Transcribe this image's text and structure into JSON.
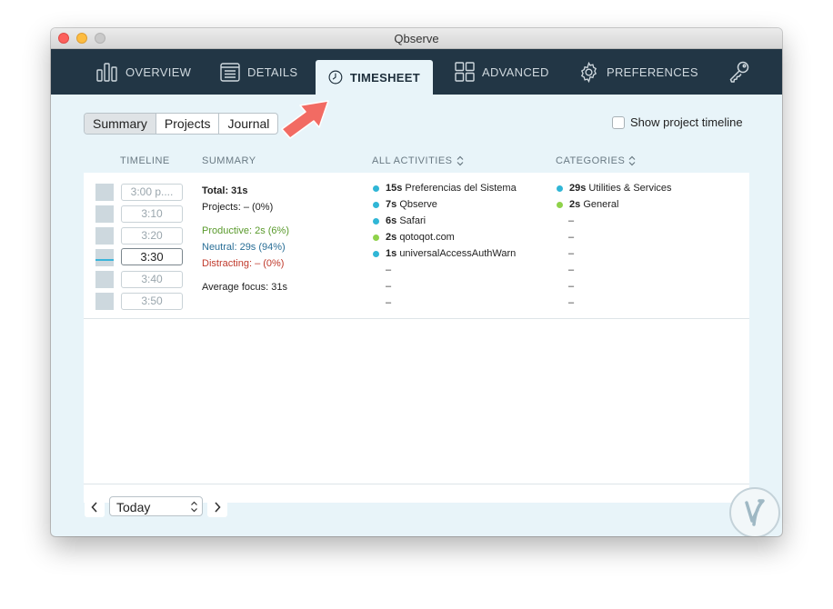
{
  "window": {
    "title": "Qbserve"
  },
  "tabs": [
    {
      "label": "OVERVIEW",
      "icon": "bar-chart-icon"
    },
    {
      "label": "DETAILS",
      "icon": "list-icon"
    },
    {
      "label": "TIMESHEET",
      "icon": "clock-icon",
      "active": true
    },
    {
      "label": "ADVANCED",
      "icon": "grid-icon"
    },
    {
      "label": "PREFERENCES",
      "icon": "gear-icon"
    }
  ],
  "key_icon": "key-icon",
  "segments": {
    "summary": "Summary",
    "projects": "Projects",
    "journal": "Journal",
    "selected": "Summary"
  },
  "timeline_toggle": {
    "label": "Show project timeline",
    "checked": false
  },
  "table": {
    "headers": {
      "timeline": "TIMELINE",
      "summary": "SUMMARY",
      "activities": "ALL ACTIVITIES",
      "categories": "CATEGORIES"
    },
    "times": [
      "3:00 p....",
      "3:10",
      "3:20",
      "3:30",
      "3:40",
      "3:50"
    ],
    "active_time": "3:30",
    "summary": {
      "total": "Total: 31s",
      "projects": "Projects: – (0%)",
      "productive": "Productive: 2s (6%)",
      "neutral": "Neutral: 29s (94%)",
      "distracting": "Distracting: – (0%)",
      "focus": "Average focus: 31s"
    },
    "activities": [
      {
        "dur": "15s",
        "name": "Preferencias del Sistema",
        "color": "#30b6d6"
      },
      {
        "dur": "7s",
        "name": "Qbserve",
        "color": "#30b6d6"
      },
      {
        "dur": "6s",
        "name": "Safari",
        "color": "#30b6d6"
      },
      {
        "dur": "2s",
        "name": "qotoqot.com",
        "color": "#8fd24a"
      },
      {
        "dur": "1s",
        "name": "universalAccessAuthWarn",
        "color": "#30b6d6"
      }
    ],
    "activity_dashes": [
      "–",
      "–",
      "–"
    ],
    "categories": [
      {
        "dur": "29s",
        "name": "Utilities & Services",
        "color": "#30b6d6"
      },
      {
        "dur": "2s",
        "name": "General",
        "color": "#8fd24a"
      }
    ],
    "category_dashes": [
      "–",
      "–",
      "–",
      "–",
      "–",
      "–"
    ]
  },
  "date_nav": {
    "value": "Today",
    "prev_icon": "chevron-left-icon",
    "next_icon": "chevron-right-icon"
  },
  "colors": {
    "toolbar": "#223645",
    "productive": "#5a9a2c",
    "neutral": "#2a6f97",
    "distracting": "#c0392b",
    "neutral_dot": "#30b6d6",
    "productive_dot": "#8fd24a",
    "arrow": "#f26b63"
  }
}
